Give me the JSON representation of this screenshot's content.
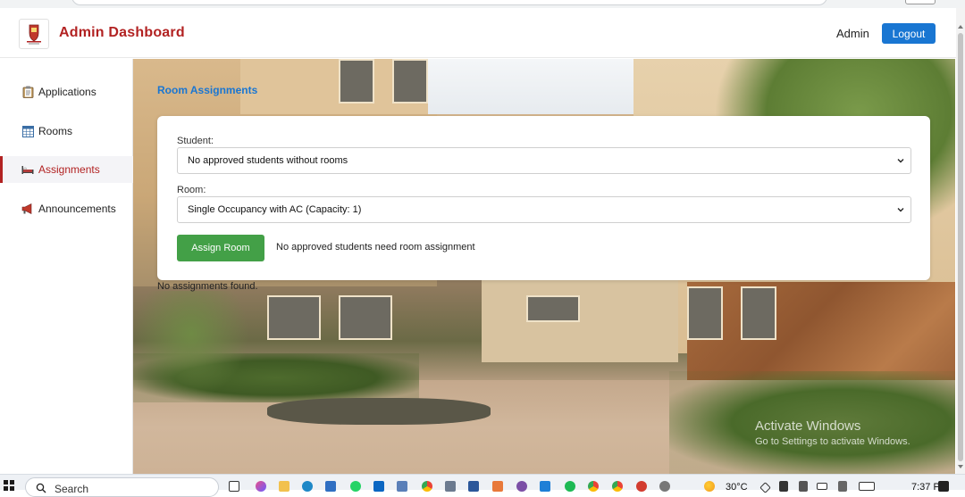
{
  "header": {
    "title": "Admin Dashboard",
    "user": "Admin",
    "logout_label": "Logout"
  },
  "sidebar": {
    "items": [
      {
        "label": "Applications",
        "icon": "clipboard-icon"
      },
      {
        "label": "Rooms",
        "icon": "calendar-grid-icon"
      },
      {
        "label": "Assignments",
        "icon": "bed-icon",
        "active": true
      },
      {
        "label": "Announcements",
        "icon": "megaphone-icon"
      }
    ]
  },
  "main": {
    "section_title": "Room Assignments",
    "student_label": "Student:",
    "student_value": "No approved students without rooms",
    "room_label": "Room:",
    "room_value": "Single Occupancy with AC (Capacity: 1)",
    "assign_label": "Assign Room",
    "assign_note": "No approved students need room assignment",
    "empty_text": "No assignments found."
  },
  "watermark": {
    "line1": "Activate Windows",
    "line2": "Go to Settings to activate Windows."
  },
  "taskbar": {
    "search_label": "Search",
    "temperature": "30°C",
    "time": "7:37 PM"
  },
  "colors": {
    "brand_red": "#b22222",
    "primary_blue": "#1976d2",
    "success_green": "#43a047"
  }
}
